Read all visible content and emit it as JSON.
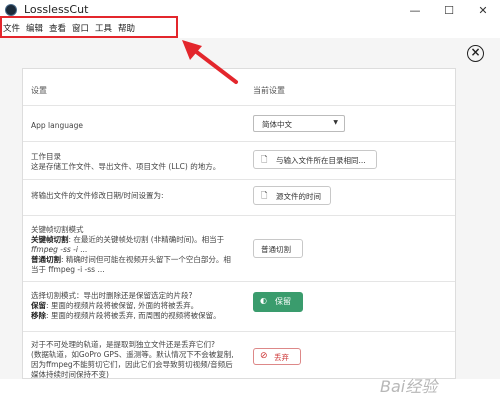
{
  "window": {
    "title": "LosslessCut",
    "minimize": "—",
    "maximize": "☐",
    "close": "✕"
  },
  "menu": [
    "文件",
    "编辑",
    "查看",
    "窗口",
    "工具",
    "帮助"
  ],
  "settings": {
    "col_setting": "设置",
    "col_current": "当前设置",
    "rows": [
      {
        "label": "App language",
        "value": "简体中文"
      },
      {
        "label_line1": "工作目录",
        "label_line2": "这是存储工作文件、导出文件、项目文件 (LLC) 的地方。",
        "value": "与输入文件所在目录相同..."
      },
      {
        "label": "将输出文件的文件修改日期/时间设置为:",
        "value": "源文件的时间"
      },
      {
        "title": "关键帧切割模式",
        "line1_b": "关键帧切割",
        "line1": ": 在最近的关键帧处切割 (非精确时间)。相当于",
        "line2": "ffmpeg -ss -i ...",
        "line3_b": "普通切割",
        "line3": ": 精确时间但可能在视频开头留下一个空白部分。相",
        "line4": "当于 ffmpeg -i -ss ...",
        "value": "普通切割"
      },
      {
        "title": "选择切割模式：导出时删除还是保留选定的片段?",
        "line1_b": "保留",
        "line1": ": 里面的视频片段将被保留, 外面的将被丢弃。",
        "line2_b": "移除",
        "line2": ": 里面的视频片段将被丢弃, 而周围的视频将被保留。",
        "value": "保留"
      },
      {
        "line1": "对于不可处理的轨道，是提取到独立文件还是丢弃它们?",
        "line2": "(数据轨道，如GoPro GPS、遥测等。默认情况下不会被复制,",
        "line3": "因为ffmpeg不能剪切它们，因此它们会导致剪切视频/音频后",
        "line4": "媒体持续时间保持不变)",
        "value": "丢弃"
      }
    ]
  },
  "watermark": "Bai经验"
}
